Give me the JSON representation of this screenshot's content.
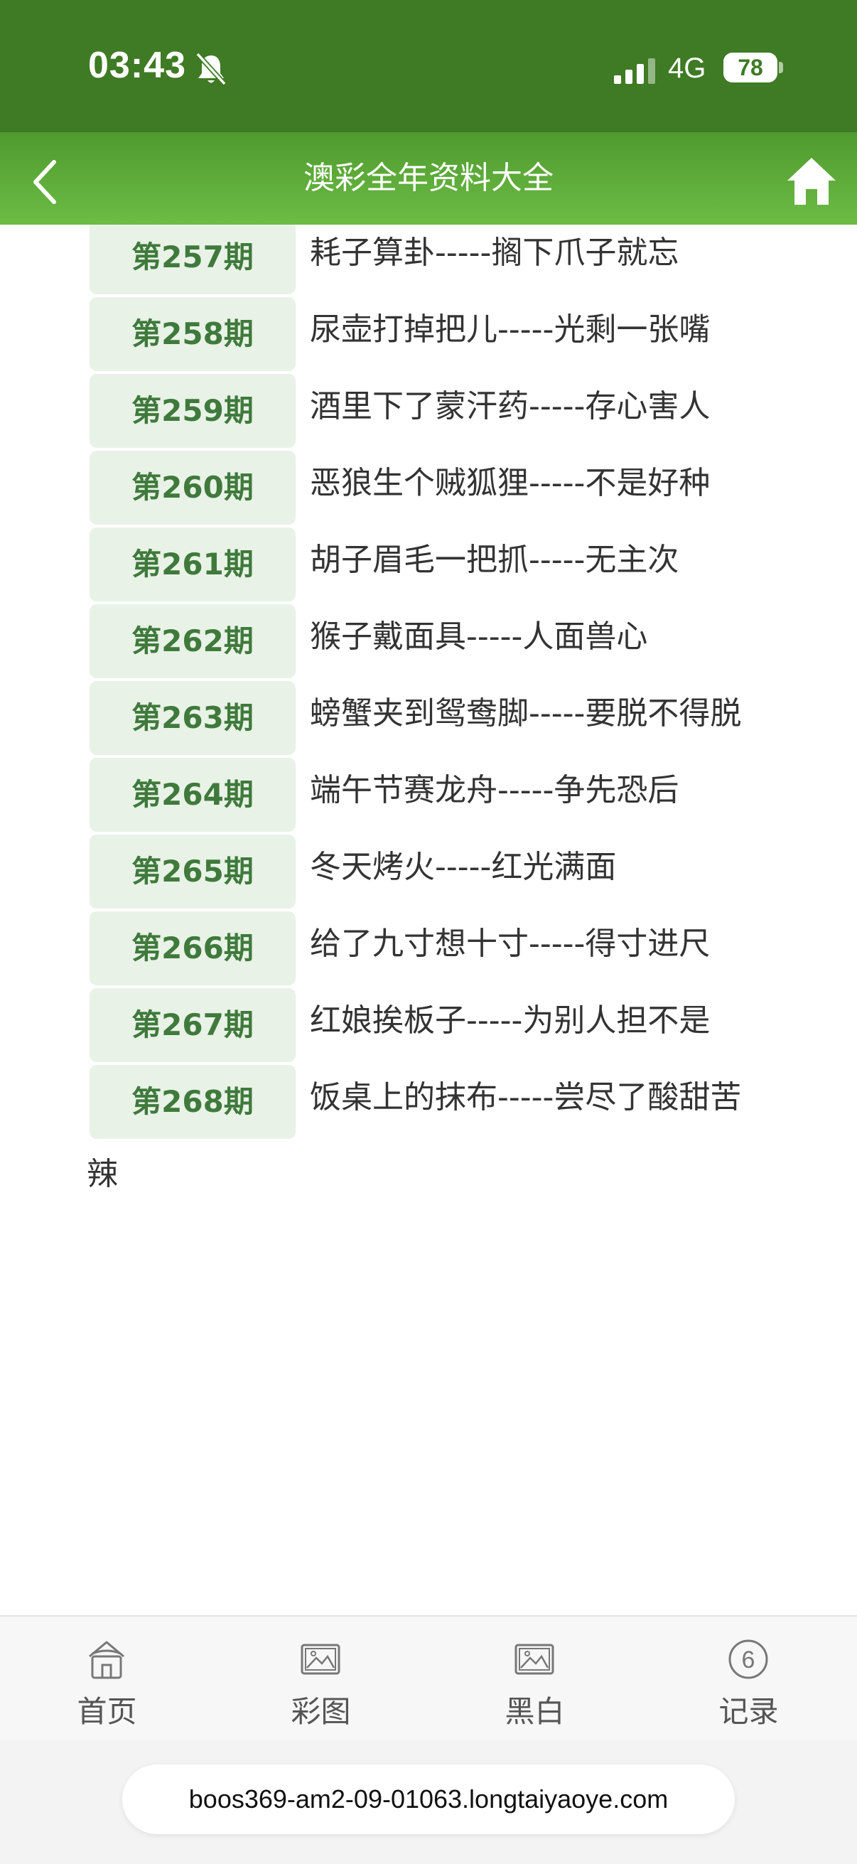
{
  "status_bar": {
    "time": "03:43",
    "network": "4G",
    "battery": "78",
    "battery_level": 0.78
  },
  "nav": {
    "title": "澳彩全年资料大全"
  },
  "entries": [
    {
      "issue": "第257期",
      "text": "耗子算卦-----搁下爪子就忘"
    },
    {
      "issue": "第258期",
      "text": "尿壶打掉把儿-----光剩一张嘴"
    },
    {
      "issue": "第259期",
      "text": "酒里下了蒙汗药-----存心害人"
    },
    {
      "issue": "第260期",
      "text": "恶狼生个贼狐狸-----不是好种"
    },
    {
      "issue": "第261期",
      "text": "胡子眉毛一把抓-----无主次"
    },
    {
      "issue": "第262期",
      "text": "猴子戴面具-----人面兽心"
    },
    {
      "issue": "第263期",
      "text": "螃蟹夹到鸳鸯脚-----要脱不得脱"
    },
    {
      "issue": "第264期",
      "text": "端午节赛龙舟-----争先恐后"
    },
    {
      "issue": "第265期",
      "text": "冬天烤火-----红光满面"
    },
    {
      "issue": "第266期",
      "text": "给了九寸想十寸-----得寸进尺"
    },
    {
      "issue": "第267期",
      "text": "红娘挨板子-----为别人担不是"
    },
    {
      "issue": "第268期",
      "text": "饭桌上的抹布-----尝尽了酸甜苦辣"
    }
  ],
  "tabs": [
    {
      "label": "首页",
      "icon": "home-outline-icon"
    },
    {
      "label": "彩图",
      "icon": "picture-icon"
    },
    {
      "label": "黑白",
      "icon": "picture-icon"
    },
    {
      "label": "记录",
      "icon": "number-six-icon",
      "badge": "6"
    }
  ],
  "url": "boos369-am2-09-01063.longtaiyaoye.com",
  "colors": {
    "status_bar": "#3f7a24",
    "nav_bar": "#5fac38",
    "badge_bg": "#e9f2e7",
    "badge_text": "#3f7a3c"
  }
}
